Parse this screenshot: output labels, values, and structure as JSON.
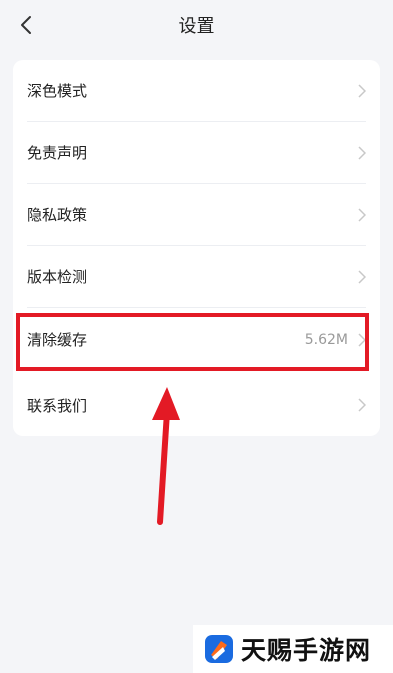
{
  "header": {
    "title": "设置"
  },
  "settings": {
    "items": [
      {
        "label": "深色模式",
        "value": ""
      },
      {
        "label": "免责声明",
        "value": ""
      },
      {
        "label": "隐私政策",
        "value": ""
      },
      {
        "label": "版本检测",
        "value": ""
      },
      {
        "label": "清除缓存",
        "value": "5.62M"
      },
      {
        "label": "联系我们",
        "value": ""
      }
    ]
  },
  "watermark": {
    "text": "天赐手游网"
  },
  "colors": {
    "highlight": "#e31a25",
    "background": "#f4f5f8",
    "card": "#ffffff"
  }
}
